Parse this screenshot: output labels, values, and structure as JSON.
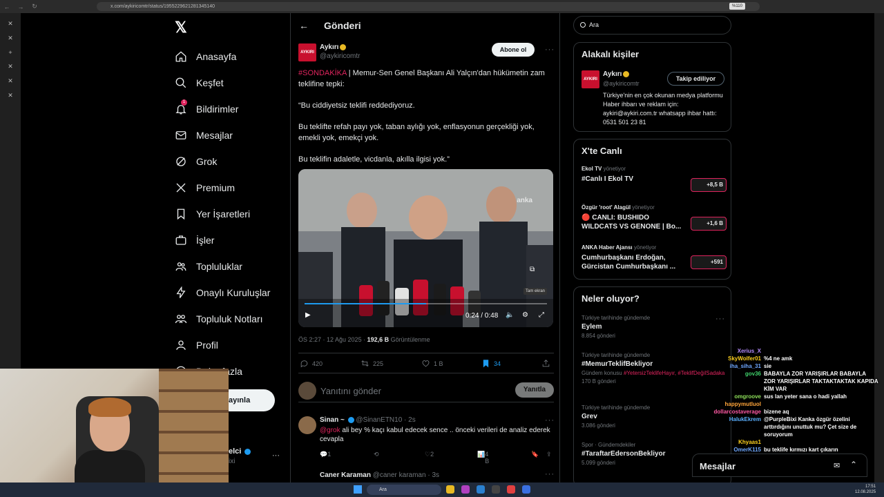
{
  "browser": {
    "url": "x.com/aykiricomtr/status/1955229621281345140",
    "zoom": "%110"
  },
  "sidebar": {
    "items": [
      {
        "label": "Anasayfa",
        "icon": "home-icon"
      },
      {
        "label": "Keşfet",
        "icon": "search-icon"
      },
      {
        "label": "Bildirimler",
        "icon": "bell-icon",
        "badge": "1"
      },
      {
        "label": "Mesajlar",
        "icon": "mail-icon"
      },
      {
        "label": "Grok",
        "icon": "grok-icon"
      },
      {
        "label": "Premium",
        "icon": "x-logo-icon"
      },
      {
        "label": "Yer İşaretleri",
        "icon": "bookmark-icon"
      },
      {
        "label": "İşler",
        "icon": "briefcase-icon"
      },
      {
        "label": "Topluluklar",
        "icon": "people-icon"
      },
      {
        "label": "Onaylı Kuruluşlar",
        "icon": "lightning-icon"
      },
      {
        "label": "Topluluk Notları",
        "icon": "notes-icon"
      },
      {
        "label": "Profil",
        "icon": "person-icon"
      },
      {
        "label": "Daha fazla",
        "icon": "more-circle-icon"
      }
    ],
    "post_button": "ayınla",
    "user_name_fragment": "elci",
    "user_handle_fragment": "ixi"
  },
  "main": {
    "title": "Gönderi",
    "tweet": {
      "name": "Aykırı",
      "handle": "@aykiricomtr",
      "avatar_text": "AYKIRI",
      "follow_label": "Abone ol",
      "hashtag": "#SONDAKİKA",
      "text_1": " | Memur-Sen Genel Başkanı Ali Yalçın'dan hükümetin zam teklifine tepki:",
      "text_2": "“Bu ciddiyetsiz teklifi reddediyoruz.",
      "text_3": "Bu teklifte refah payı yok, taban aylığı yok, enflasyonun gerçekliği yok, emekli yok, emekçi yok.",
      "text_4": "Bu teklifin adaletle, vicdanla, akılla ilgisi yok.”",
      "video": {
        "watermark": "anka",
        "time": "0:24 / 0:48",
        "progress": 0.5,
        "tooltip": "Tam ekran"
      },
      "date": "ÖS 2:27 · 12 Ağu 2025 · ",
      "views": "192,6 B",
      "views_label": " Görüntülenme",
      "replies": "420",
      "retweets": "225",
      "likes": "1 B",
      "bookmarks": "34"
    },
    "reply_placeholder": "Yanıtını gönder",
    "reply_button": "Yanıtla",
    "reply": {
      "name": "Sinan ~",
      "handle": "@SinanETN10 · 2s",
      "mention": "@grok",
      "text": " ali bey % kaçı kabul edecek sence .. önceki verileri de analiz ederek cevapla",
      "replies": "1",
      "likes": "2",
      "views": "4 B"
    },
    "next_reply": {
      "name": "Caner Karaman",
      "handle": "@caner karaman · 3s"
    }
  },
  "right": {
    "search_value": "Ara",
    "related": {
      "title": "Alakalı kişiler",
      "name": "Aykırı",
      "handle": "@aykiricomtr",
      "button": "Takip ediliyor",
      "bio": "Türkiye'nin en çok okunan medya platformu Haber ihbarı ve reklam için: aykiri@aykiri.com.tr whatsapp ihbar hattı: 0531 501 23 81"
    },
    "live": {
      "title": "X'te Canlı",
      "items": [
        {
          "host": "Ekol TV",
          "role": " yönetiyor",
          "title": "#Canlı I Ekol TV",
          "count": "+8,5 B"
        },
        {
          "host": "Özgür 'root' Alagül",
          "role": " yönetiyor",
          "title": "🔴 CANLI: BUSHIDO WILDCATS VS GENONE | Bo...",
          "count": "+1,6 B"
        },
        {
          "host": "ANKA Haber Ajansı",
          "role": " yönetiyor",
          "title": "Cumhurbaşkanı Erdoğan, Gürcistan Cumhurbaşkanı ...",
          "count": "+591"
        }
      ]
    },
    "trends": {
      "title": "Neler oluyor?",
      "items": [
        {
          "cat": "Türkiye tarihinde gündemde",
          "title": "Eylem",
          "count": "8.854 gönderi"
        },
        {
          "cat": "Türkiye tarihinde gündemde",
          "title": "#MemurTeklifBekliyor",
          "sub_prefix": "Gündem konusu ",
          "sub_tags": "#YetersizTeklifeHayır, #TeklifDeğilSadaka",
          "count": "170 B gönderi"
        },
        {
          "cat": "Türkiye tarihinde gündemde",
          "title": "Grev",
          "count": "3.086 gönderi"
        },
        {
          "cat": "Spor · Gündemdekiler",
          "title": "#TaraftarEdersonBekliyor",
          "count": "5.099 gönderi"
        }
      ]
    },
    "messages": "Mesajlar"
  },
  "chat": [
    {
      "user": "Xerius_X",
      "msg": "",
      "color": "#b58cff"
    },
    {
      "user": "SkyWolfer01",
      "msg": "%4 ne amk",
      "color": "#ffd21f"
    },
    {
      "user": "iha_siha_31",
      "msg": "sie",
      "color": "#6fa8ff"
    },
    {
      "user": "gov36",
      "msg": "BABAYLA ZOR YARIŞIRLAR BABAYLA ZOR YARIŞIRLAR TAKTAKTAKTAK KAPIDA KİM VAR",
      "color": "#3fd16b"
    },
    {
      "user": "omgroove",
      "msg": "sus lan yeter sana o hadi yallah",
      "color": "#8ee05a"
    },
    {
      "user": "happymutluol",
      "msg": "",
      "color": "#ffa53a"
    },
    {
      "user": "dollarcostaverage",
      "msg": "bizene aq",
      "color": "#ff5aa5"
    },
    {
      "user": "HalukEkrem",
      "msg": "@PurpleBixi Kanka özgür özelini arttırdığını unuttuk mu? Çet size de soruyorum",
      "color": "#5ab0ff"
    },
    {
      "user": "Khyaas1",
      "msg": "",
      "color": "#ffd21f"
    },
    {
      "user": "OmerK115",
      "msg": "bu teklife kırmızı kart çıkarın",
      "color": "#6fa8ff"
    }
  ],
  "taskbar": {
    "search": "Ara",
    "time": "17:51",
    "date": "12.08.2025"
  }
}
